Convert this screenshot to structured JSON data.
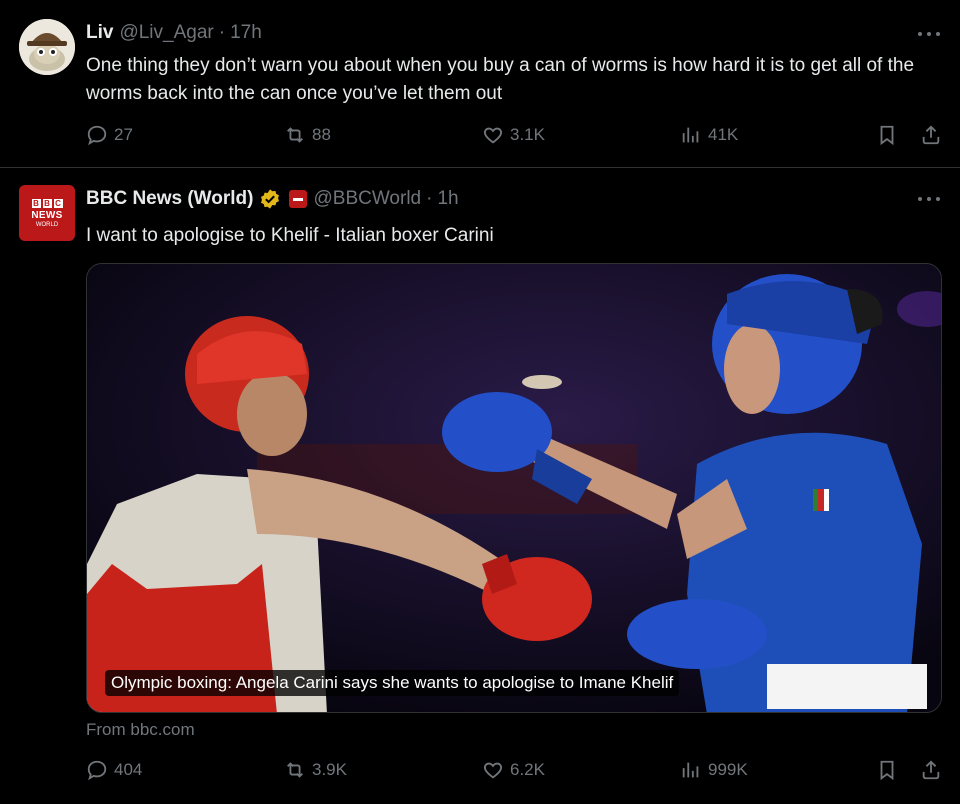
{
  "tweets": [
    {
      "author": {
        "name": "Liv",
        "handle": "@Liv_Agar",
        "time": "17h",
        "avatar_icon": "frog-hat-avatar"
      },
      "text": "One thing they don’t warn you about when you buy a can of worms is how hard it is to get all of the worms back into the can once you’ve let them out",
      "actions": {
        "replies": "27",
        "retweets": "88",
        "likes": "3.1K",
        "views": "41K"
      }
    },
    {
      "author": {
        "name": "BBC News (World)",
        "handle": "@BBCWorld",
        "time": "1h",
        "verified": true,
        "verified_color": "#e2b719",
        "logo": {
          "blocks": [
            "B",
            "B",
            "C"
          ],
          "line1": "NEWS",
          "line2": "WORLD"
        }
      },
      "text": "I want to apologise to Khelif - Italian boxer Carini",
      "media": {
        "caption": "Olympic boxing: Angela Carini says she wants to apologise to Imane Khelif",
        "source": "From bbc.com"
      },
      "actions": {
        "replies": "404",
        "retweets": "3.9K",
        "likes": "6.2K",
        "views": "999K"
      }
    }
  ],
  "colors": {
    "background": "#000000",
    "text": "#e7e9ea",
    "muted": "#71767b",
    "divider": "#2f3336",
    "bbc_red": "#bb1919"
  }
}
